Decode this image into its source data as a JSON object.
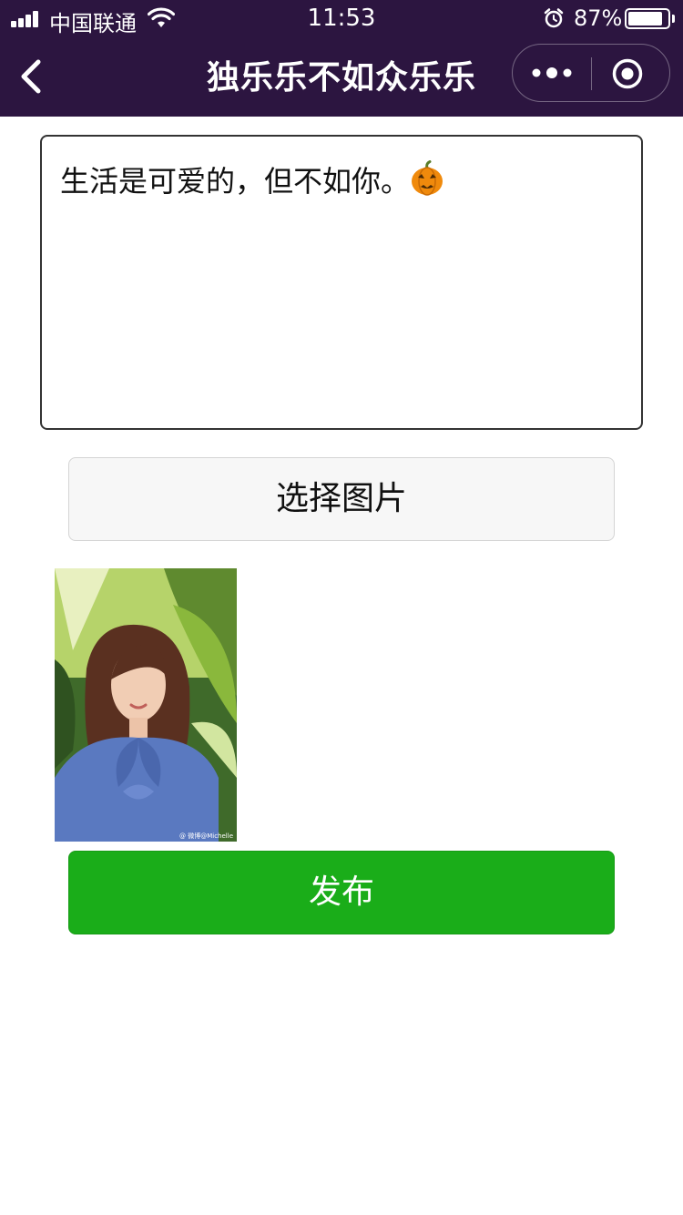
{
  "status_bar": {
    "carrier": "中国联通",
    "time": "11:53",
    "battery_percent": "87%",
    "battery_level": 0.87
  },
  "nav": {
    "title": "独乐乐不如众乐乐"
  },
  "composer": {
    "text": "生活是可爱的，但不如你。"
  },
  "actions": {
    "choose_image_label": "选择图片",
    "publish_label": "发布"
  },
  "photo": {
    "watermark": "@ 微博@Michelle"
  },
  "colors": {
    "nav_bg": "#2c1540",
    "publish_green": "#1aad19",
    "choose_bg": "#f7f7f7"
  },
  "icons": {
    "back": "chevron-left-icon",
    "more": "more-dots-icon",
    "close": "target-circle-icon",
    "emoji": "pumpkin-emoji-icon"
  }
}
